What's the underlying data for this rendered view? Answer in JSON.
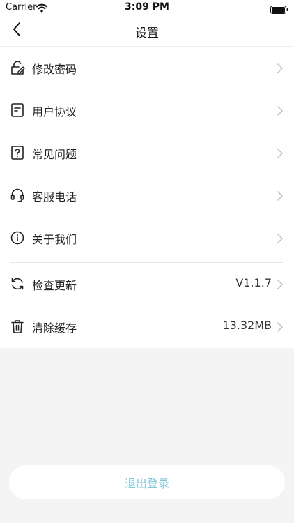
{
  "status_bar": {
    "carrier": "Carrier",
    "time": "3:09 PM"
  },
  "header": {
    "title": "设置"
  },
  "menu": {
    "items": [
      {
        "label": "修改密码",
        "icon": "edit-lock-icon"
      },
      {
        "label": "用户协议",
        "icon": "document-icon"
      },
      {
        "label": "常见问题",
        "icon": "question-icon"
      },
      {
        "label": "客服电话",
        "icon": "headset-icon"
      },
      {
        "label": "关于我们",
        "icon": "info-icon"
      },
      {
        "label": "检查更新",
        "icon": "refresh-icon",
        "value": "V1.1.7"
      },
      {
        "label": "清除缓存",
        "icon": "trash-icon",
        "value": "13.32MB"
      }
    ]
  },
  "footer": {
    "logout_label": "退出登录"
  },
  "colors": {
    "background": "#f4f4f4",
    "card": "#ffffff",
    "logout_text": "#7fc7d6"
  }
}
